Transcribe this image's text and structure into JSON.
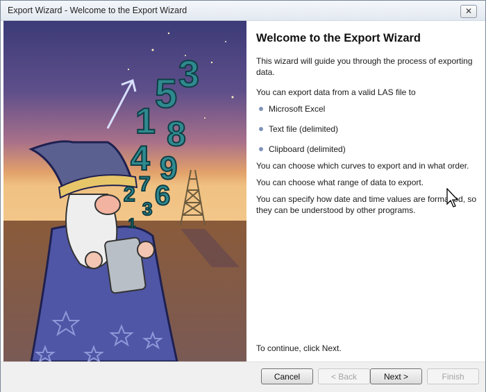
{
  "window": {
    "title": "Export Wizard - Welcome to the Export Wizard",
    "close_glyph": "✕"
  },
  "art": {
    "numbers": [
      "5",
      "3",
      "1",
      "8",
      "4",
      "9",
      "2",
      "7",
      "6",
      "3",
      "1"
    ]
  },
  "content": {
    "heading": "Welcome to the Export Wizard",
    "intro": "This wizard will guide you through the process of exporting data.",
    "export_from": "You can export data from a valid LAS file to",
    "targets": [
      "Microsoft Excel",
      "Text file (delimited)",
      "Clipboard (delimited)"
    ],
    "curves": "You can choose which curves to export and in what order.",
    "range": "You can choose what range of data to export.",
    "format": "You can specify how date and time values are formatted, so they can be understood by other programs.",
    "continue": "To continue, click Next."
  },
  "buttons": {
    "cancel": "Cancel",
    "back": "< Back",
    "next": "Next >",
    "finish": "Finish"
  },
  "colors": {
    "bullet": "#7f93b8",
    "digits": "#2f8a90"
  }
}
